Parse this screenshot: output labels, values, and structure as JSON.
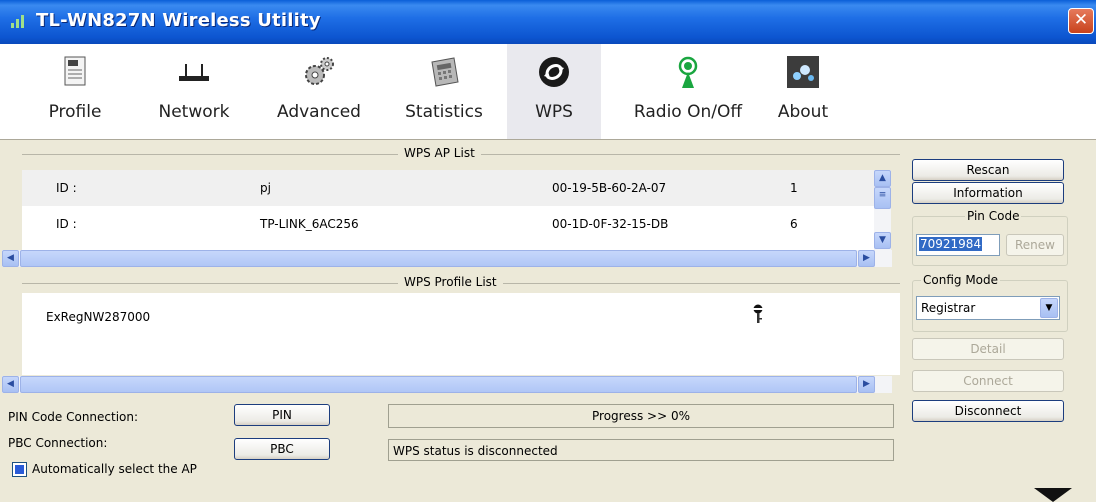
{
  "window": {
    "title": "TL-WN827N Wireless Utility",
    "close_glyph": "✕"
  },
  "toolbar": {
    "items": [
      {
        "label": "Profile",
        "icon": "profile-icon"
      },
      {
        "label": "Network",
        "icon": "network-icon"
      },
      {
        "label": "Advanced",
        "icon": "advanced-gear-icon"
      },
      {
        "label": "Statistics",
        "icon": "statistics-icon"
      },
      {
        "label": "WPS",
        "icon": "wps-icon",
        "active": true
      },
      {
        "label": "Radio On/Off",
        "icon": "radio-antenna-icon"
      },
      {
        "label": "About",
        "icon": "about-icon"
      }
    ]
  },
  "ap_list": {
    "title": "WPS AP List",
    "rows": [
      {
        "id_label": "ID :",
        "ssid": "pj",
        "bssid": "00-19-5B-60-2A-07",
        "channel": "1"
      },
      {
        "id_label": "ID :",
        "ssid": "TP-LINK_6AC256",
        "bssid": "00-1D-0F-32-15-DB",
        "channel": "6"
      }
    ]
  },
  "profile_list": {
    "title": "WPS Profile List",
    "rows": [
      {
        "name": "ExRegNW287000"
      }
    ]
  },
  "buttons": {
    "rescan": "Rescan",
    "information": "Information",
    "renew": "Renew",
    "detail": "Detail",
    "connect": "Connect",
    "disconnect": "Disconnect",
    "pin": "PIN",
    "pbc": "PBC"
  },
  "pin_code": {
    "label": "Pin Code",
    "value": "70921984"
  },
  "config_mode": {
    "label": "Config Mode",
    "value": "Registrar"
  },
  "connections": {
    "pin_label": "PIN Code Connection:",
    "pbc_label": "PBC Connection:"
  },
  "progress": {
    "text": "Progress >> 0%",
    "percent": 0
  },
  "status": {
    "text": "WPS status is disconnected"
  },
  "auto_select": {
    "label": "Automatically select the AP",
    "checked": true
  },
  "colors": {
    "titlebar": "#0c55d0",
    "selection": "#316ac5",
    "face": "#ece9d8"
  }
}
